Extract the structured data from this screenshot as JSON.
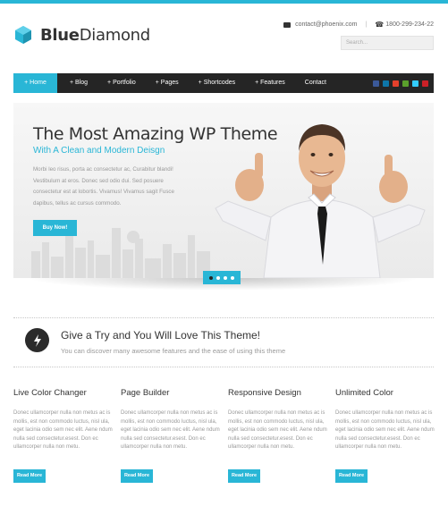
{
  "brand": {
    "name_bold": "Blue",
    "name_regular": "Diamond",
    "accent": "#29b6d6"
  },
  "contact": {
    "email": "contact@phoenix.com",
    "separator": "|",
    "phone": "1800-299-234-22"
  },
  "search": {
    "placeholder": "Search..."
  },
  "nav": {
    "items": [
      "+ Home",
      "+ Blog",
      "+ Portfolio",
      "+ Pages",
      "+ Shortcodes",
      "+ Features",
      "Contact"
    ],
    "active_index": 0,
    "social": [
      {
        "name": "facebook-icon",
        "color": "#3b5998"
      },
      {
        "name": "linkedin-icon",
        "color": "#0e76a8"
      },
      {
        "name": "youtube-icon",
        "color": "#e4402c"
      },
      {
        "name": "flickr-icon",
        "color": "#5aa02c"
      },
      {
        "name": "twitter-icon",
        "color": "#33ccff"
      },
      {
        "name": "pinterest-icon",
        "color": "#cb2027"
      }
    ]
  },
  "hero": {
    "title": "The Most Amazing WP Theme",
    "subtitle": "With A Clean and Modern Deisgn",
    "body": "Morbi leo risus, porta ac consectetur ac, Curabitur blandi! Vestibulum at eros. Donec sed odio dui. Sed posuere consectetur est at lobortis. Vivamus! Vivamus sagit Fusce dapibus, tellus ac cursus commodo.",
    "button": "Buy Now!",
    "slides": 4,
    "active_slide": 0
  },
  "promo": {
    "icon": "lightning-icon",
    "title": "Give a Try and You Will Love This Theme!",
    "subtitle": "You can discover many awesome features and the ease of using this theme"
  },
  "features": [
    {
      "title": "Live Color Changer",
      "text": "Donec ullamcorper nulla non metus ac is mollis, est non commodo luctus, nisl ula, eget lacinia odio sem nec elit. Aene ndum nulla sed consectetur.esest. Don ec ullamcorper nulla non metu.",
      "button": "Read More"
    },
    {
      "title": "Page Builder",
      "text": "Donec ullamcorper nulla non metus ac is mollis, est non commodo luctus, nisl ula, eget lacinia odio sem nec elit. Aene ndum nulla sed consectetur.esest. Don ec ullamcorper nulla non metu.",
      "button": "Read More"
    },
    {
      "title": "Responsive Design",
      "text": "Donec ullamcorper nulla non metus ac is mollis, est non commodo luctus, nisl ula, eget lacinia odio sem nec elit. Aene ndum nulla sed consectetur.esest. Don ec ullamcorper nulla non metu.",
      "button": "Read More"
    },
    {
      "title": "Unlimited Color",
      "text": "Donec ullamcorper nulla non metus ac is mollis, est non commodo luctus, nisl ula, eget lacinia odio sem nec elit. Aene ndum nulla sed consectetur.esest. Don ec ullamcorper nulla non metu.",
      "button": "Read More"
    }
  ]
}
